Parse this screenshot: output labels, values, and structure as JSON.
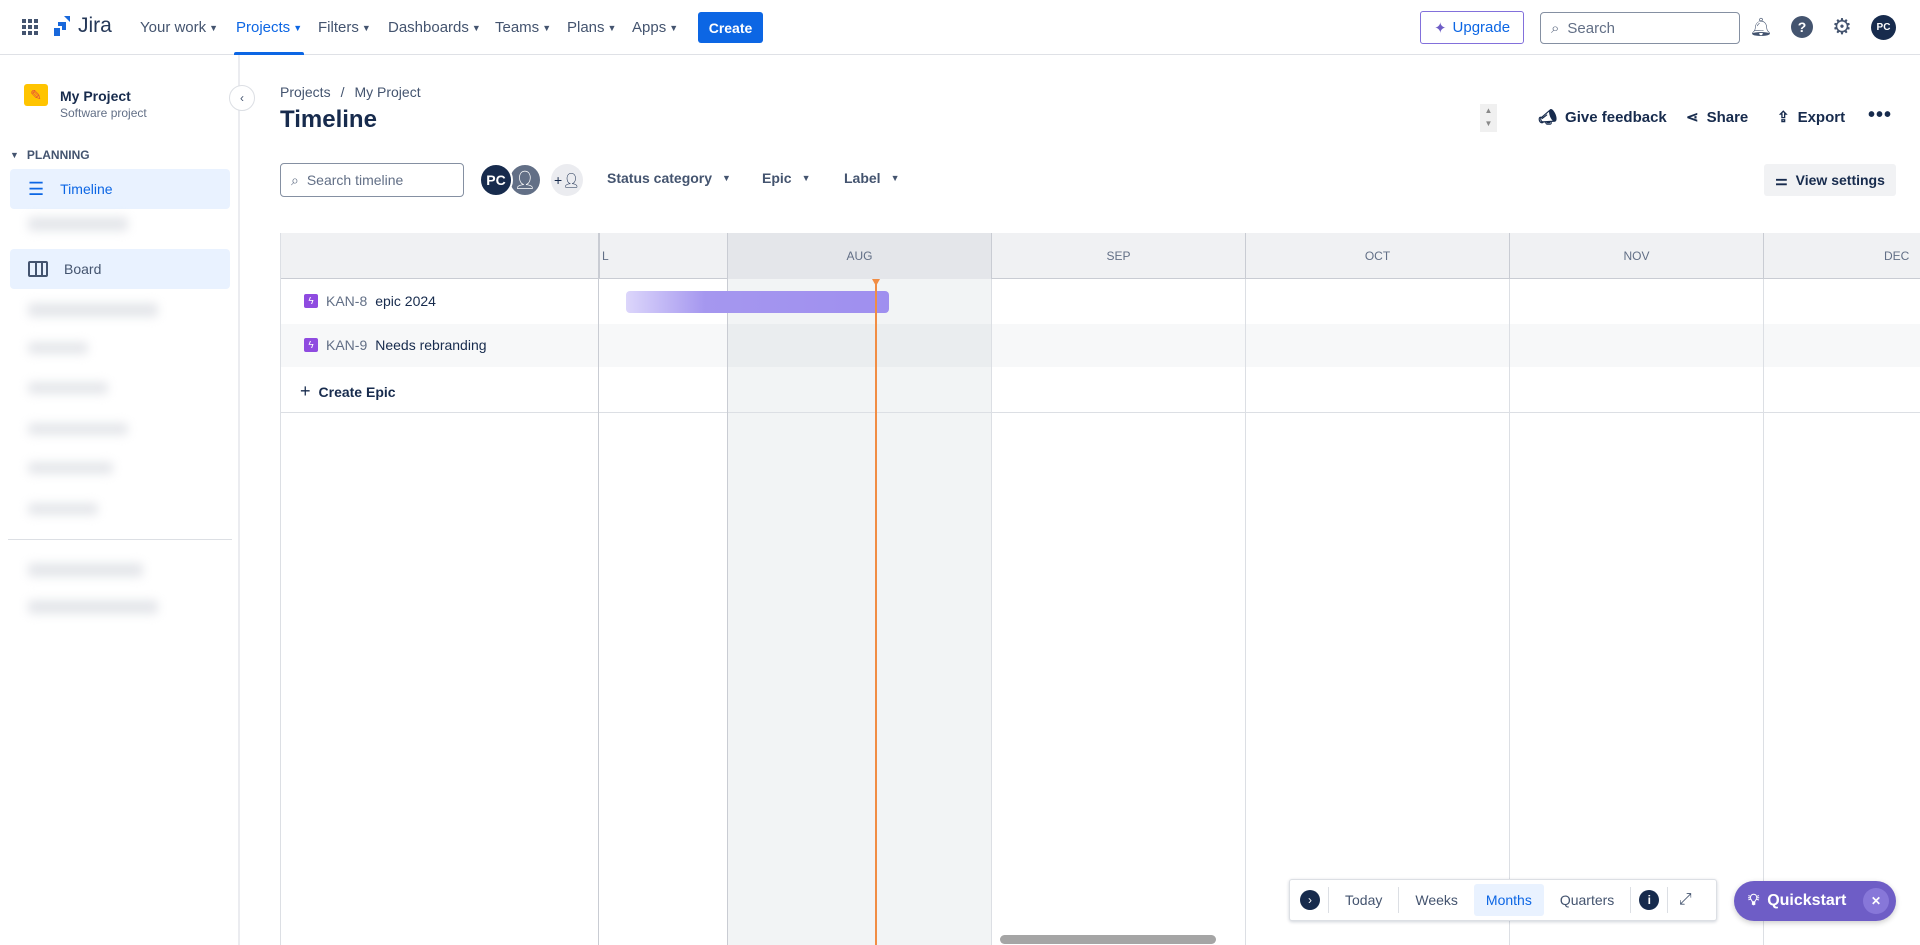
{
  "topnav": {
    "logo": "Jira",
    "items": [
      {
        "label": "Your work"
      },
      {
        "label": "Projects",
        "active": true
      },
      {
        "label": "Filters"
      },
      {
        "label": "Dashboards"
      },
      {
        "label": "Teams"
      },
      {
        "label": "Plans"
      },
      {
        "label": "Apps"
      }
    ],
    "create_label": "Create",
    "upgrade_label": "Upgrade",
    "search_placeholder": "Search",
    "avatar_initials": "PC"
  },
  "sidebar": {
    "project_name": "My Project",
    "project_type": "Software project",
    "section_label": "PLANNING",
    "items": [
      {
        "label": "Timeline",
        "active": true
      },
      {
        "label": "Board"
      }
    ]
  },
  "page": {
    "breadcrumb": [
      "Projects",
      "My Project"
    ],
    "breadcrumb_sep": "/",
    "title": "Timeline",
    "actions": {
      "feedback": "Give feedback",
      "share": "Share",
      "export": "Export"
    },
    "search_placeholder": "Search timeline",
    "avatar_initials": "PC",
    "filters": [
      "Status category",
      "Epic",
      "Label"
    ],
    "view_settings": "View settings"
  },
  "timeline": {
    "months": [
      "L",
      "AUG",
      "SEP",
      "OCT",
      "NOV",
      "DEC"
    ],
    "rows": [
      {
        "key": "KAN-8",
        "summary": "epic 2024"
      },
      {
        "key": "KAN-9",
        "summary": "Needs rebranding"
      }
    ],
    "create_label": "Create Epic",
    "colors": {
      "bar": "#9f8fef",
      "today": "#f18d44",
      "epic": "#8f4be0"
    }
  },
  "toolbar": {
    "today": "Today",
    "weeks": "Weeks",
    "months": "Months",
    "quarters": "Quarters",
    "selected": "Months"
  },
  "quickstart": {
    "label": "Quickstart"
  }
}
